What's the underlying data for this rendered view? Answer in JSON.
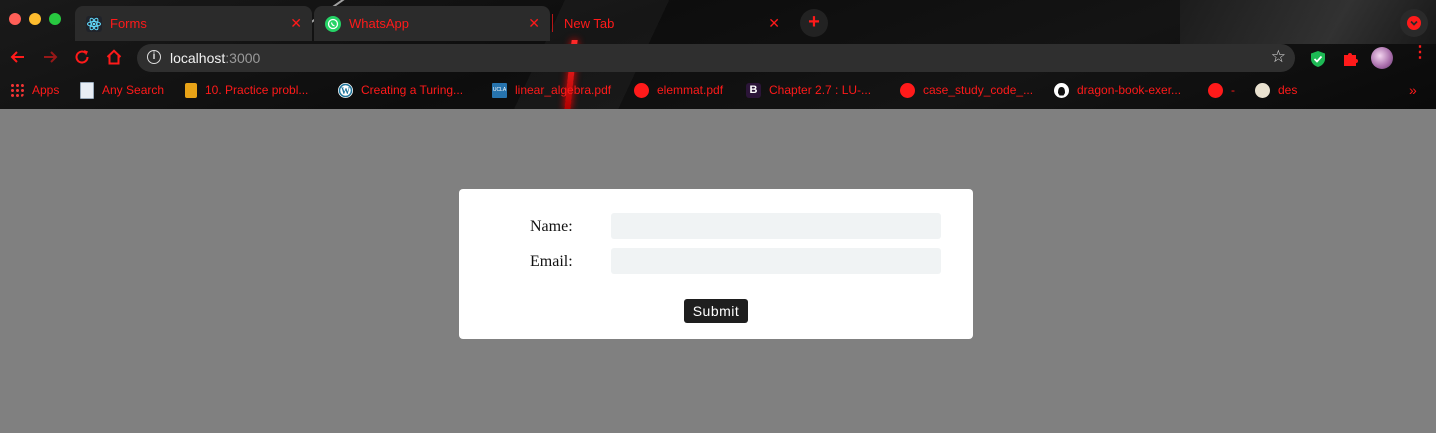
{
  "browser": {
    "tabs": [
      {
        "title": "Forms",
        "icon": "react-icon",
        "active": true
      },
      {
        "title": "WhatsApp",
        "icon": "whatsapp-icon",
        "active": true
      },
      {
        "title": "New Tab",
        "icon": "",
        "active": false
      }
    ],
    "tab_close_glyph": "✕",
    "new_tab_glyph": "+",
    "address": {
      "host": "localhost",
      "port": ":3000"
    },
    "bookmarks": [
      {
        "label": "Apps",
        "icon": "apps-grid-icon"
      },
      {
        "label": "Any Search",
        "icon": "document-icon"
      },
      {
        "label": "10. Practice probl...",
        "icon": "site-icon"
      },
      {
        "label": "Creating a Turing...",
        "icon": "wordpress-icon"
      },
      {
        "label": "linear_algebra.pdf",
        "icon": "ucla-icon"
      },
      {
        "label": "elemmat.pdf",
        "icon": "globe-icon"
      },
      {
        "label": "Chapter 2.7 : LU-...",
        "icon": "bootstrap-icon"
      },
      {
        "label": "case_study_code_...",
        "icon": "globe-icon"
      },
      {
        "label": "dragon-book-exer...",
        "icon": "github-icon"
      },
      {
        "label": "-",
        "icon": "globe-icon"
      },
      {
        "label": "des",
        "icon": "viking-icon"
      }
    ],
    "bookmarks_more": "»",
    "colors": {
      "accent": "#ff1a1a",
      "chrome_bg": "#141414",
      "page_bg": "#808080"
    }
  },
  "form": {
    "name_label": "Name:",
    "email_label": "Email:",
    "name_value": "",
    "email_value": "",
    "submit_label": "Submit"
  }
}
